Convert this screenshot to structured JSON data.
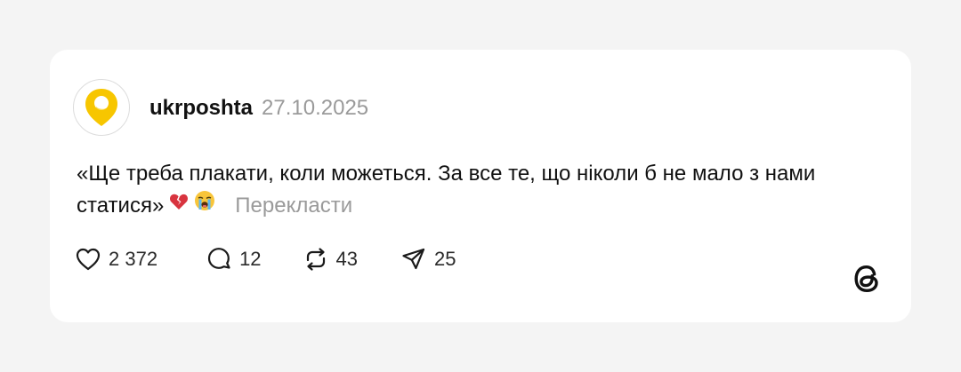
{
  "post": {
    "username": "ukrposhta",
    "date": "27.10.2025",
    "text": "«Ще треба плакати, коли можеться. За все те, що ніколи б не мало з нами статися»",
    "translate_label": "Перекласти",
    "emojis": [
      "broken-heart-emoji",
      "loudly-crying-face-emoji"
    ]
  },
  "actions": {
    "likes": "2 372",
    "comments": "12",
    "reposts": "43",
    "shares": "25"
  },
  "colors": {
    "card": "#ffffff",
    "background": "#f4f4f4",
    "avatar_accent": "#f7c600",
    "muted_text": "#9a9a9a"
  },
  "icons": {
    "like": "heart-icon",
    "comment": "comment-bubble-icon",
    "repost": "repost-icon",
    "share": "send-icon",
    "brand": "threads-logo-icon"
  }
}
